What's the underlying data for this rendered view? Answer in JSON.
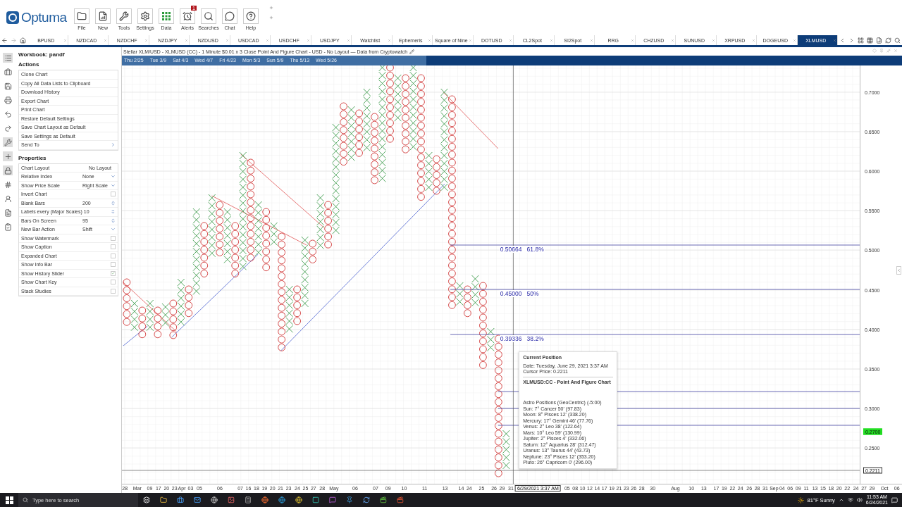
{
  "app": {
    "logo": "Optuma"
  },
  "toolbar": [
    {
      "label": "File"
    },
    {
      "label": "New"
    },
    {
      "label": "Tools"
    },
    {
      "label": "Settings"
    },
    {
      "label": "Data"
    },
    {
      "label": "Alerts",
      "badge": "1"
    },
    {
      "label": "Searches"
    },
    {
      "label": "Chat"
    },
    {
      "label": "Help"
    }
  ],
  "tabs": [
    {
      "label": "BPUSD",
      "selected": false
    },
    {
      "label": "NZDCAD",
      "selected": false
    },
    {
      "label": "NZDCHF",
      "selected": false
    },
    {
      "label": "NZDJPY",
      "selected": false
    },
    {
      "label": "NZDUSD",
      "selected": false
    },
    {
      "label": "USDCAD",
      "selected": false
    },
    {
      "label": "USDCHF",
      "selected": false
    },
    {
      "label": "USDJPY",
      "selected": false
    },
    {
      "label": "Watchlist",
      "selected": false
    },
    {
      "label": "Ephemeris",
      "selected": false
    },
    {
      "label": "Square of Nine",
      "selected": false
    },
    {
      "label": "DOTUSD",
      "selected": false
    },
    {
      "label": "CL2Spot",
      "selected": false
    },
    {
      "label": "SI2Spot",
      "selected": false
    },
    {
      "label": "RRG",
      "selected": false
    },
    {
      "label": "CHZUSD",
      "selected": false
    },
    {
      "label": "SUNUSD",
      "selected": false
    },
    {
      "label": "XRPUSD",
      "selected": false
    },
    {
      "label": "DOGEUSD",
      "selected": false
    },
    {
      "label": "XLMUSD",
      "selected": true
    }
  ],
  "workbook": {
    "title": "Workbook: pandf"
  },
  "actions": {
    "title": "Actions",
    "items": [
      {
        "label": "Clone Chart",
        "submenu": false
      },
      {
        "label": "Copy All Data Lists to Clipboard",
        "submenu": false
      },
      {
        "label": "Download History",
        "submenu": false
      },
      {
        "label": "Export Chart",
        "submenu": false
      },
      {
        "label": "Print Chart",
        "submenu": false
      },
      {
        "label": "Restore Default Settings",
        "submenu": false
      },
      {
        "label": "Save Chart Layout as Default",
        "submenu": false
      },
      {
        "label": "Save Settings as Default",
        "submenu": false
      },
      {
        "label": "Send To",
        "submenu": true
      }
    ]
  },
  "properties": {
    "title": "Properties",
    "rows": [
      {
        "label": "Chart Layout",
        "kind": "text",
        "value": "No Layout"
      },
      {
        "label": "Relative Index",
        "kind": "select",
        "value": "None"
      },
      {
        "label": "Show Price Scale",
        "kind": "select",
        "value": "Right Scale"
      },
      {
        "label": "Invert Chart",
        "kind": "checkbox",
        "checked": false
      },
      {
        "label": "Blank Bars",
        "kind": "spin",
        "value": "200"
      },
      {
        "label": "Labels every (Major Scales)",
        "kind": "spin",
        "value": "10"
      },
      {
        "label": "Bars On Screen",
        "kind": "spin",
        "value": "95"
      },
      {
        "label": "New Bar Action",
        "kind": "select",
        "value": "Shift"
      },
      {
        "label": "Show Watermark",
        "kind": "checkbox",
        "checked": false
      },
      {
        "label": "Show Caption",
        "kind": "checkbox",
        "checked": false
      },
      {
        "label": "Expanded Chart",
        "kind": "checkbox",
        "checked": false
      },
      {
        "label": "Show Info Bar",
        "kind": "checkbox",
        "checked": false
      },
      {
        "label": "Show History Slider",
        "kind": "checkbox",
        "checked": true
      },
      {
        "label": "Show Chart Key",
        "kind": "checkbox",
        "checked": false
      },
      {
        "label": "Stack Studies",
        "kind": "checkbox",
        "checked": false
      }
    ]
  },
  "chart": {
    "title": "Stellar XLM/USD - XLMUSD (CC) - 1 Minute $0.01 x 3 Close Point And Figure Chart - USD - No Layout — Data from Cryptowatch",
    "history_slider": {
      "level": 0.39
    },
    "history_labels": [
      "Thu 2/25",
      "Tue 3/9",
      "Sat 4/3",
      "Wed 4/7",
      "Fri 4/23",
      "Mon 5/3",
      "Sun 5/9",
      "Thu 5/13",
      "Wed 5/26"
    ],
    "price_labels": [
      "0.7000",
      "0.6500",
      "0.6000",
      "0.5500",
      "0.5000",
      "0.4500",
      "0.4000",
      "0.3500",
      "0.3000",
      "0.2500"
    ],
    "price_marker": "0.2700",
    "cursor_price": "0.2211",
    "date_labels": [
      "28",
      "Mar",
      "09",
      "17",
      "20",
      "23",
      "Apr",
      "03",
      "05",
      "06",
      "07",
      "16",
      "18",
      "19",
      "20",
      "21",
      "23",
      "24",
      "25",
      "27",
      "28",
      "May",
      "06",
      "07",
      "09",
      "10",
      "11",
      "13",
      "14",
      "24",
      "25",
      "26",
      "29",
      "31",
      "05",
      "08",
      "10",
      "12",
      "14",
      "17",
      "19",
      "21",
      "23",
      "26",
      "28",
      "30",
      "Aug",
      "10",
      "13",
      "17",
      "19",
      "22",
      "24",
      "26",
      "28",
      "31",
      "Sep",
      "04",
      "06",
      "09",
      "11",
      "13",
      "15",
      "18",
      "20",
      "22",
      "24",
      "27",
      "29",
      "Oct",
      "06"
    ],
    "cursor_date": "6/29/2021 3:37 AM",
    "fib_levels": [
      {
        "price": "0.50664",
        "percent": "61.8%"
      },
      {
        "price": "0.45000",
        "percent": "50%"
      },
      {
        "price": "0.39336",
        "percent": "38.2%"
      }
    ],
    "tooltip": {
      "title": "Current Position",
      "date": "Date: Tuesday, June 29, 2021 3:37 AM",
      "price": "Cursor Price: 0.2211",
      "chart_name": "XLMUSD:CC - Point And Figure Chart",
      "astro_title": "Astro Positions (GeoCentric) (-5:00)",
      "astro": [
        "Sun: 7° Cancer 50' (97.83)",
        "Moon: 8° Pisces 12' (338.20)",
        "Mercury: 17° Gemini 46' (77.76)",
        "Venus: 2° Leo 38' (122.64)",
        "Mars: 10° Leo 59' (130.99)",
        "Jupiter: 2° Pisces 4' (332.06)",
        "Saturn: 12° Aquarius 28' (312.47)",
        "Uranus: 13° Taurus 44' (43.73)",
        "Neptune: 23° Pisces 12' (353.20)",
        "Pluto: 26° Capricorn 0' (296.00)"
      ]
    }
  },
  "taskbar": {
    "search_placeholder": "Type here to search",
    "weather": "81°F Sunny",
    "time": "11:53 AM",
    "date": "6/24/2021"
  }
}
